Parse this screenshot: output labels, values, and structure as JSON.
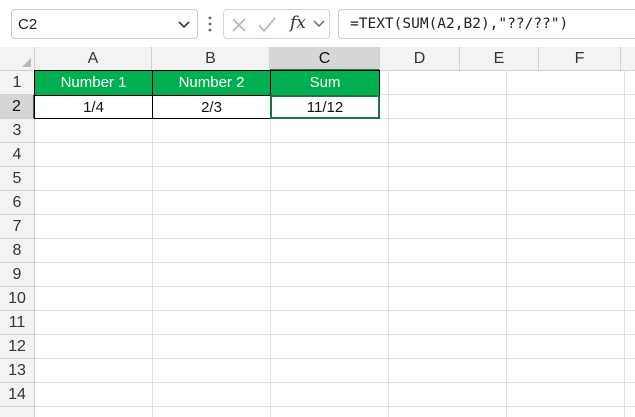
{
  "name_box": {
    "value": "C2",
    "dropdown_icon": "chevron-down-icon"
  },
  "formula_bar": {
    "cancel_icon": "close-icon",
    "enter_icon": "checkmark-icon",
    "function_icon": "fx-icon",
    "function_label": "fx",
    "formula": "=TEXT(SUM(A2,B2),\"??/??\")"
  },
  "columns": [
    "A",
    "B",
    "C",
    "D",
    "E",
    "F"
  ],
  "active_column": "C",
  "rows": [
    "1",
    "2",
    "3",
    "4",
    "5",
    "6",
    "7",
    "8",
    "9",
    "10",
    "11",
    "12",
    "13",
    "14"
  ],
  "active_row": "2",
  "table": {
    "headers": [
      "Number 1",
      "Number 2",
      "Sum"
    ],
    "header_color": "#00b050",
    "values": [
      "1/4",
      "2/3",
      "11/12"
    ]
  },
  "accent_color": "#217346"
}
